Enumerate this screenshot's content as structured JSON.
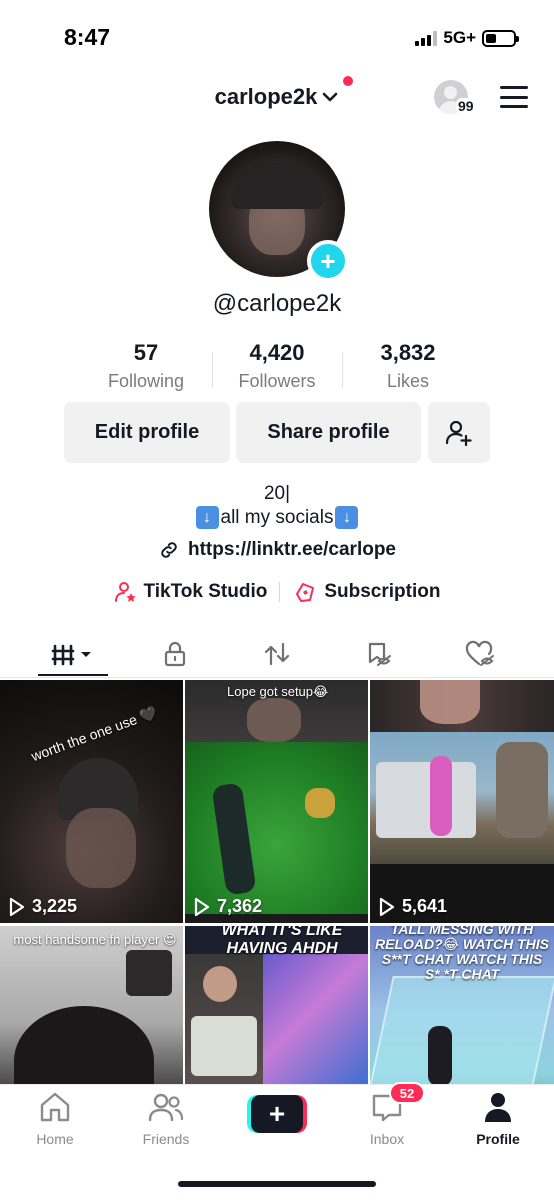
{
  "status_bar": {
    "time": "8:47",
    "network": "5G+"
  },
  "header": {
    "username": "carlope2k",
    "profile_views_count": "99"
  },
  "profile": {
    "handle": "@carlope2k",
    "add_symbol": "+"
  },
  "stats": [
    {
      "value": "57",
      "label": "Following"
    },
    {
      "value": "4,420",
      "label": "Followers"
    },
    {
      "value": "3,832",
      "label": "Likes"
    }
  ],
  "buttons": {
    "edit_profile": "Edit profile",
    "share_profile": "Share profile"
  },
  "bio": {
    "line1": "20|",
    "line2": "all my socials",
    "link": "https://linktr.ee/carlope"
  },
  "studio_row": {
    "studio": "TikTok Studio",
    "subscription": "Subscription"
  },
  "tabs": [
    "videos-tab",
    "private-tab",
    "reposts-tab",
    "favorites-tab",
    "liked-tab"
  ],
  "videos": [
    {
      "caption": "worth the one use 🖤",
      "views": "3,225"
    },
    {
      "caption": "Lope got setup😂",
      "views": "7,362"
    },
    {
      "caption": "",
      "views": "5,641"
    },
    {
      "caption": "most handsome fn player 😍",
      "views": ""
    },
    {
      "caption": "WHAT IT'S LIKE HAVING AHDH",
      "views": ""
    },
    {
      "caption": "TALL MESSING WITH RELOAD?😂 WATCH THIS S**T CHAT WATCH THIS S* *T CHAT",
      "views": ""
    }
  ],
  "bottom_nav": {
    "home": "Home",
    "friends": "Friends",
    "inbox": "Inbox",
    "inbox_badge": "52",
    "profile": "Profile",
    "create": "+"
  },
  "colors": {
    "accent_red": "#fe2c55",
    "accent_cyan": "#25f4ee",
    "add_badge": "#20d5ec"
  }
}
